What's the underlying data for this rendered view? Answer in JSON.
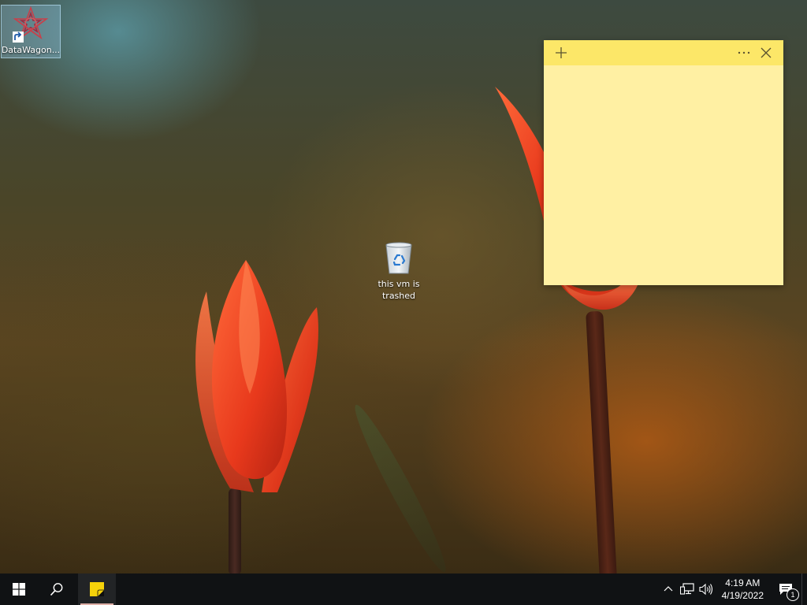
{
  "desktop": {
    "icons": [
      {
        "label": "DataWagon...",
        "icon": "datawagon-app-icon",
        "shortcut": true
      },
      {
        "label": "this vm is trashed",
        "icon": "recycle-bin-icon"
      }
    ]
  },
  "sticky_note": {
    "title": "",
    "content": "",
    "new_note_icon": "plus-icon",
    "menu_icon": "more-icon",
    "close_icon": "close-icon",
    "header_color": "#fce768",
    "body_color": "#fff0a3"
  },
  "taskbar": {
    "start_icon": "windows-logo-icon",
    "search_icon": "search-icon",
    "pinned_apps": [
      {
        "name": "Sticky Notes",
        "icon": "sticky-notes-icon",
        "active": true
      }
    ],
    "tray": {
      "show_hidden_icon": "chevron-up-icon",
      "network_icon": "network-icon",
      "volume_icon": "volume-icon",
      "time": "4:19 AM",
      "date": "4/19/2022",
      "notification_count": "1"
    }
  }
}
